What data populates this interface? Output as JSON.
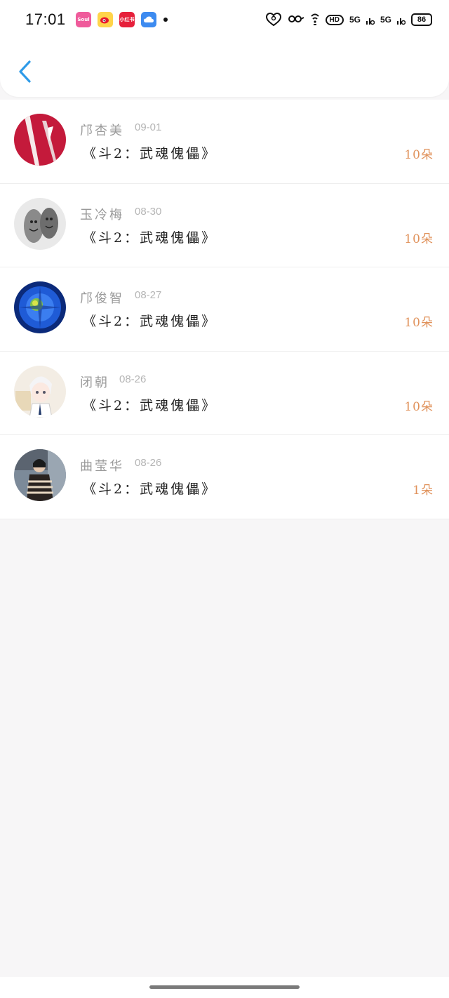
{
  "status_bar": {
    "time": "17:01",
    "apps": [
      {
        "icon": "soul-app-icon",
        "label": "Soul"
      },
      {
        "icon": "weibo-icon",
        "label": ""
      },
      {
        "icon": "xiaohongshu-icon",
        "label": "小红书"
      },
      {
        "icon": "cloud-icon",
        "label": ""
      }
    ],
    "signal_1": "5G",
    "signal_2": "5G",
    "hd": "HD",
    "battery": "86"
  },
  "header": {
    "back_icon": "chevron-left-icon",
    "accent": "#2f9be8"
  },
  "records": [
    {
      "name": "邝杏美",
      "date": "09-01",
      "title": "《斗2：武魂傀儡》",
      "count": "10朵"
    },
    {
      "name": "玉冷梅",
      "date": "08-30",
      "title": "《斗2：武魂傀儡》",
      "count": "10朵"
    },
    {
      "name": "邝俊智",
      "date": "08-27",
      "title": "《斗2：武魂傀儡》",
      "count": "10朵"
    },
    {
      "name": "闭朝",
      "date": "08-26",
      "title": "《斗2：武魂傀儡》",
      "count": "10朵"
    },
    {
      "name": "曲莹华",
      "date": "08-26",
      "title": "《斗2：武魂傀儡》",
      "count": "1朵"
    }
  ],
  "colors": {
    "count_text": "#e0915a",
    "name_text": "#9a9a9a",
    "background": "#f7f6f7"
  }
}
